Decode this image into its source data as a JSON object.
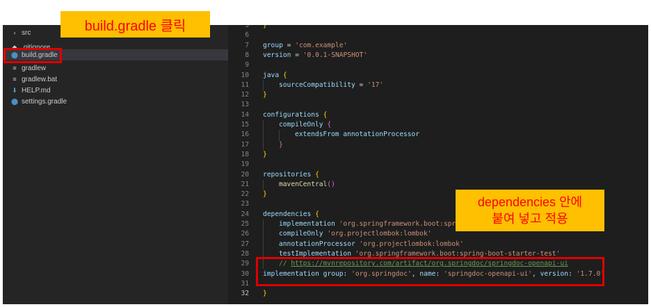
{
  "explorer": {
    "items": [
      {
        "icon": "›",
        "label": "src"
      },
      {
        "icon": "◆",
        "label": ".gitignore"
      },
      {
        "icon": "⬤",
        "label": "build.gradle"
      },
      {
        "icon": "≡",
        "label": "gradlew"
      },
      {
        "icon": "≡",
        "label": "gradlew.bat"
      },
      {
        "icon": "⬇",
        "label": "HELP.md"
      },
      {
        "icon": "⬤",
        "label": "settings.gradle"
      }
    ]
  },
  "editor": {
    "active_line": 32,
    "lines": [
      {
        "n": 5,
        "indent": 0,
        "tokens": [
          [
            "b1",
            "}"
          ]
        ]
      },
      {
        "n": 6,
        "indent": 0,
        "tokens": []
      },
      {
        "n": 7,
        "indent": 0,
        "tokens": [
          [
            "id",
            "group"
          ],
          [
            "plain",
            " = "
          ],
          [
            "str",
            "'com.example'"
          ]
        ]
      },
      {
        "n": 8,
        "indent": 0,
        "tokens": [
          [
            "id",
            "version"
          ],
          [
            "plain",
            " = "
          ],
          [
            "str",
            "'0.0.1-SNAPSHOT'"
          ]
        ]
      },
      {
        "n": 9,
        "indent": 0,
        "tokens": []
      },
      {
        "n": 10,
        "indent": 0,
        "tokens": [
          [
            "id",
            "java"
          ],
          [
            "plain",
            " "
          ],
          [
            "b1",
            "{"
          ]
        ]
      },
      {
        "n": 11,
        "indent": 1,
        "tokens": [
          [
            "id",
            "sourceCompatibility"
          ],
          [
            "plain",
            " = "
          ],
          [
            "str",
            "'17'"
          ]
        ]
      },
      {
        "n": 12,
        "indent": 0,
        "tokens": [
          [
            "b1",
            "}"
          ]
        ]
      },
      {
        "n": 13,
        "indent": 0,
        "tokens": []
      },
      {
        "n": 14,
        "indent": 0,
        "tokens": [
          [
            "id",
            "configurations"
          ],
          [
            "plain",
            " "
          ],
          [
            "b1",
            "{"
          ]
        ]
      },
      {
        "n": 15,
        "indent": 1,
        "tokens": [
          [
            "id",
            "compileOnly"
          ],
          [
            "plain",
            " "
          ],
          [
            "b2",
            "{"
          ]
        ]
      },
      {
        "n": 16,
        "indent": 2,
        "tokens": [
          [
            "id",
            "extendsFrom"
          ],
          [
            "plain",
            " "
          ],
          [
            "id",
            "annotationProcessor"
          ]
        ]
      },
      {
        "n": 17,
        "indent": 1,
        "tokens": [
          [
            "b2",
            "}"
          ]
        ]
      },
      {
        "n": 18,
        "indent": 0,
        "tokens": [
          [
            "b1",
            "}"
          ]
        ]
      },
      {
        "n": 19,
        "indent": 0,
        "tokens": []
      },
      {
        "n": 20,
        "indent": 0,
        "tokens": [
          [
            "id",
            "repositories"
          ],
          [
            "plain",
            " "
          ],
          [
            "b1",
            "{"
          ]
        ]
      },
      {
        "n": 21,
        "indent": 1,
        "tokens": [
          [
            "fn",
            "mavenCentral"
          ],
          [
            "b2",
            "()"
          ]
        ]
      },
      {
        "n": 22,
        "indent": 0,
        "tokens": [
          [
            "b1",
            "}"
          ]
        ]
      },
      {
        "n": 23,
        "indent": 0,
        "tokens": []
      },
      {
        "n": 24,
        "indent": 0,
        "tokens": [
          [
            "id",
            "dependencies"
          ],
          [
            "plain",
            " "
          ],
          [
            "b1",
            "{"
          ]
        ]
      },
      {
        "n": 25,
        "indent": 1,
        "tokens": [
          [
            "id",
            "implementation"
          ],
          [
            "plain",
            " "
          ],
          [
            "str",
            "'org.springframework.boot:spring-boot-starter-web'"
          ]
        ]
      },
      {
        "n": 26,
        "indent": 1,
        "tokens": [
          [
            "id",
            "compileOnly"
          ],
          [
            "plain",
            " "
          ],
          [
            "str",
            "'org.projectlombok:lombok'"
          ]
        ]
      },
      {
        "n": 27,
        "indent": 1,
        "tokens": [
          [
            "id",
            "annotationProcessor"
          ],
          [
            "plain",
            " "
          ],
          [
            "str",
            "'org.projectlombok:lombok'"
          ]
        ]
      },
      {
        "n": 28,
        "indent": 1,
        "tokens": [
          [
            "id",
            "testImplementation"
          ],
          [
            "plain",
            " "
          ],
          [
            "str",
            "'org.springframework.boot:spring-boot-starter-test'"
          ]
        ]
      },
      {
        "n": 29,
        "indent": 1,
        "tokens": [
          [
            "cm",
            "// "
          ],
          [
            "link",
            "https://mvnrepository.com/artifact/org.springdoc/springdoc-openapi-ui"
          ]
        ]
      },
      {
        "n": 30,
        "indent": 0,
        "tokens": [
          [
            "id",
            "implementation"
          ],
          [
            "plain",
            " "
          ],
          [
            "id",
            "group"
          ],
          [
            "plain",
            ": "
          ],
          [
            "str",
            "'org.springdoc'"
          ],
          [
            "plain",
            ", "
          ],
          [
            "id",
            "name"
          ],
          [
            "plain",
            ": "
          ],
          [
            "str",
            "'springdoc-openapi-ui'"
          ],
          [
            "plain",
            ", "
          ],
          [
            "id",
            "version"
          ],
          [
            "plain",
            ": "
          ],
          [
            "str",
            "'1.7.0'"
          ]
        ]
      },
      {
        "n": 31,
        "indent": 0,
        "tokens": []
      },
      {
        "n": 32,
        "indent": 0,
        "tokens": [
          [
            "b1",
            "}"
          ]
        ]
      }
    ]
  },
  "annotations": {
    "click_label": "build.gradle 클릭",
    "paste_line1": "dependencies 안에",
    "paste_line2": "붙여 넣고 적용"
  },
  "colors": {
    "callout_bg": "#fec000",
    "callout_text": "#ff0000",
    "highlight_border": "#e00000"
  }
}
